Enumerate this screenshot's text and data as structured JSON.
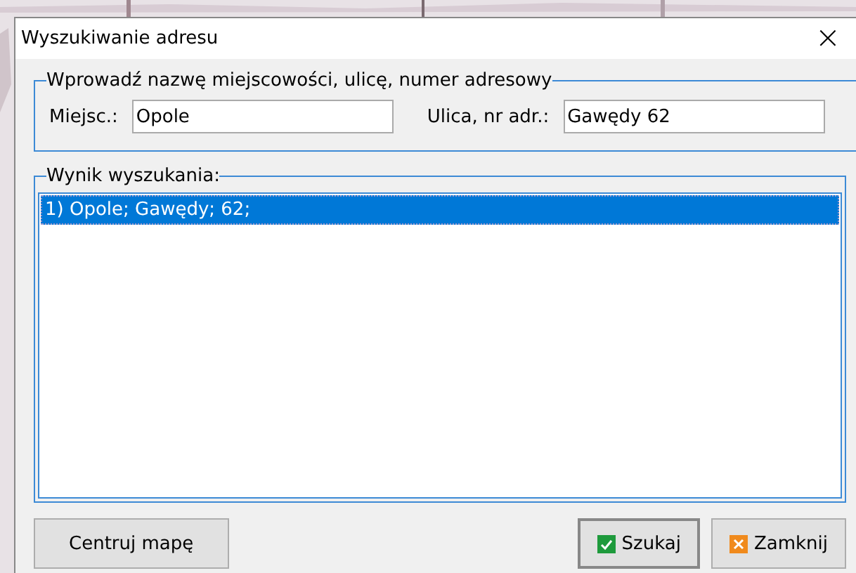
{
  "window": {
    "title": "Wyszukiwanie adresu",
    "close": "×"
  },
  "address_group": {
    "legend": "Wprowadź nazwę miejscowości, ulicę,  numer adresowy",
    "fields": [
      {
        "label": "Miejsc.:",
        "value": "Opole"
      },
      {
        "label": "Ulica, nr adr.:",
        "value": "Gawędy 62"
      }
    ]
  },
  "results_group": {
    "legend": "Wynik wyszukania:",
    "items": [
      {
        "text": "1) Opole; Gawędy; 62;",
        "selected": true
      }
    ]
  },
  "buttons": [
    {
      "label": "Centruj mapę",
      "kind": "plain"
    },
    {
      "label": "Szukaj",
      "kind": "ok",
      "default": true
    },
    {
      "label": "Zamknij",
      "kind": "cancel",
      "default": false
    }
  ]
}
